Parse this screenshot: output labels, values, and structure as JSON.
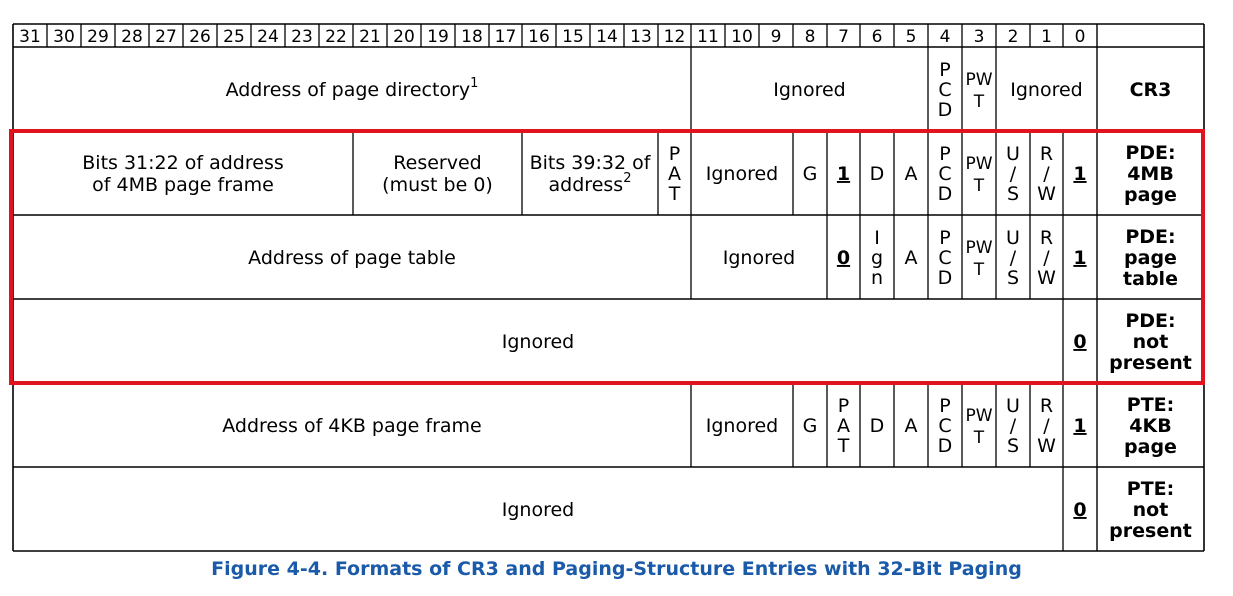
{
  "bit_numbers": [
    "31",
    "30",
    "29",
    "28",
    "27",
    "26",
    "25",
    "24",
    "23",
    "22",
    "21",
    "20",
    "19",
    "18",
    "17",
    "16",
    "15",
    "14",
    "13",
    "12",
    "11",
    "10",
    "9",
    "8",
    "7",
    "6",
    "5",
    "4",
    "3",
    "2",
    "1",
    "0"
  ],
  "rows": [
    {
      "id": "cr3",
      "label": [
        "CR3"
      ],
      "fields": [
        {
          "hi": 31,
          "lo": 12,
          "text": [
            "Address of page directory"
          ],
          "sup": "1"
        },
        {
          "hi": 11,
          "lo": 5,
          "text": [
            "Ignored"
          ]
        },
        {
          "hi": 4,
          "lo": 4,
          "text": [
            "P",
            "C",
            "D"
          ]
        },
        {
          "hi": 3,
          "lo": 3,
          "text": [
            "PW",
            "T"
          ]
        },
        {
          "hi": 2,
          "lo": 0,
          "text": [
            "Ignored"
          ]
        }
      ]
    },
    {
      "id": "pde-4mb",
      "label": [
        "PDE:",
        "4MB",
        "page"
      ],
      "fields": [
        {
          "hi": 31,
          "lo": 22,
          "text": [
            "Bits 31:22 of address",
            "of 4MB page frame"
          ]
        },
        {
          "hi": 21,
          "lo": 17,
          "text": [
            "Reserved",
            "(must be 0)"
          ]
        },
        {
          "hi": 16,
          "lo": 13,
          "text": [
            "Bits 39:32 of",
            "address"
          ],
          "sup": "2"
        },
        {
          "hi": 12,
          "lo": 12,
          "text": [
            "P",
            "A",
            "T"
          ]
        },
        {
          "hi": 11,
          "lo": 9,
          "text": [
            "Ignored"
          ]
        },
        {
          "hi": 8,
          "lo": 8,
          "text": [
            "G"
          ]
        },
        {
          "hi": 7,
          "lo": 7,
          "text": [
            "1"
          ],
          "underline": true
        },
        {
          "hi": 6,
          "lo": 6,
          "text": [
            "D"
          ]
        },
        {
          "hi": 5,
          "lo": 5,
          "text": [
            "A"
          ]
        },
        {
          "hi": 4,
          "lo": 4,
          "text": [
            "P",
            "C",
            "D"
          ]
        },
        {
          "hi": 3,
          "lo": 3,
          "text": [
            "PW",
            "T"
          ]
        },
        {
          "hi": 2,
          "lo": 2,
          "text": [
            "U",
            "/",
            "S"
          ]
        },
        {
          "hi": 1,
          "lo": 1,
          "text": [
            "R",
            "/",
            "W"
          ]
        },
        {
          "hi": 0,
          "lo": 0,
          "text": [
            "1"
          ],
          "underline": true
        }
      ]
    },
    {
      "id": "pde-pt",
      "label": [
        "PDE:",
        "page",
        "table"
      ],
      "fields": [
        {
          "hi": 31,
          "lo": 12,
          "text": [
            "Address of page table"
          ]
        },
        {
          "hi": 11,
          "lo": 8,
          "text": [
            "Ignored"
          ]
        },
        {
          "hi": 7,
          "lo": 7,
          "text": [
            "0"
          ],
          "underline": true
        },
        {
          "hi": 6,
          "lo": 6,
          "text": [
            "I",
            "g",
            "n"
          ]
        },
        {
          "hi": 5,
          "lo": 5,
          "text": [
            "A"
          ]
        },
        {
          "hi": 4,
          "lo": 4,
          "text": [
            "P",
            "C",
            "D"
          ]
        },
        {
          "hi": 3,
          "lo": 3,
          "text": [
            "PW",
            "T"
          ]
        },
        {
          "hi": 2,
          "lo": 2,
          "text": [
            "U",
            "/",
            "S"
          ]
        },
        {
          "hi": 1,
          "lo": 1,
          "text": [
            "R",
            "/",
            "W"
          ]
        },
        {
          "hi": 0,
          "lo": 0,
          "text": [
            "1"
          ],
          "underline": true
        }
      ]
    },
    {
      "id": "pde-np",
      "label": [
        "PDE:",
        "not",
        "present"
      ],
      "fields": [
        {
          "hi": 31,
          "lo": 1,
          "text": [
            "Ignored"
          ]
        },
        {
          "hi": 0,
          "lo": 0,
          "text": [
            "0"
          ],
          "underline": true
        }
      ]
    },
    {
      "id": "pte-4kb",
      "label": [
        "PTE:",
        "4KB",
        "page"
      ],
      "fields": [
        {
          "hi": 31,
          "lo": 12,
          "text": [
            "Address of 4KB page frame"
          ]
        },
        {
          "hi": 11,
          "lo": 9,
          "text": [
            "Ignored"
          ]
        },
        {
          "hi": 8,
          "lo": 8,
          "text": [
            "G"
          ]
        },
        {
          "hi": 7,
          "lo": 7,
          "text": [
            "P",
            "A",
            "T"
          ]
        },
        {
          "hi": 6,
          "lo": 6,
          "text": [
            "D"
          ]
        },
        {
          "hi": 5,
          "lo": 5,
          "text": [
            "A"
          ]
        },
        {
          "hi": 4,
          "lo": 4,
          "text": [
            "P",
            "C",
            "D"
          ]
        },
        {
          "hi": 3,
          "lo": 3,
          "text": [
            "PW",
            "T"
          ]
        },
        {
          "hi": 2,
          "lo": 2,
          "text": [
            "U",
            "/",
            "S"
          ]
        },
        {
          "hi": 1,
          "lo": 1,
          "text": [
            "R",
            "/",
            "W"
          ]
        },
        {
          "hi": 0,
          "lo": 0,
          "text": [
            "1"
          ],
          "underline": true
        }
      ]
    },
    {
      "id": "pte-np",
      "label": [
        "PTE:",
        "not",
        "present"
      ],
      "fields": [
        {
          "hi": 31,
          "lo": 1,
          "text": [
            "Ignored"
          ]
        },
        {
          "hi": 0,
          "lo": 0,
          "text": [
            "0"
          ],
          "underline": true
        }
      ]
    }
  ],
  "highlight_rows": [
    "pde-4mb",
    "pde-pt",
    "pde-np"
  ],
  "colors": {
    "highlight": "#e0141e",
    "caption": "#1a5aa8",
    "grid": "#000000"
  },
  "caption": "Figure 4-4.  Formats of CR3 and Paging-Structure Entries with 32-Bit Paging"
}
